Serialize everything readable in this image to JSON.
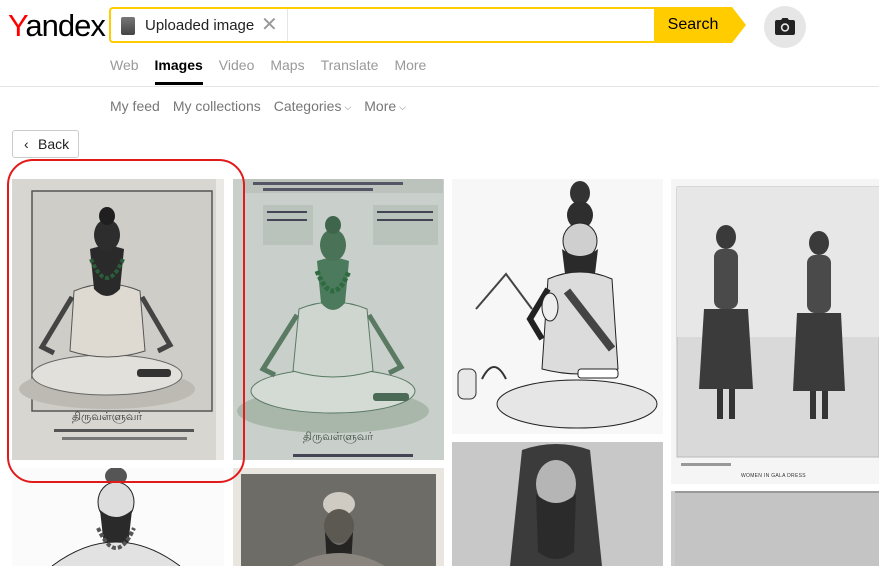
{
  "logo": {
    "first": "Y",
    "rest": "andex"
  },
  "search": {
    "uploaded_label": "Uploaded image",
    "clear_symbol": "✕",
    "button_label": "Search"
  },
  "services": [
    {
      "label": "Web"
    },
    {
      "label": "Images",
      "active": true
    },
    {
      "label": "Video"
    },
    {
      "label": "Maps"
    },
    {
      "label": "Translate"
    },
    {
      "label": "More"
    }
  ],
  "subnav": {
    "feed": "My feed",
    "collections": "My collections",
    "categories": "Categories",
    "more": "More",
    "chevron": "⌵"
  },
  "back": {
    "label": "Back",
    "chevron": "‹"
  },
  "icons": {
    "camera": "camera-icon",
    "clear": "close-icon",
    "back": "chevron-left-icon",
    "dropdown": "chevron-down-icon"
  },
  "colors": {
    "accent": "#ffcc00",
    "logo_red": "#ff0000",
    "highlight": "#e31a1a",
    "muted": "#999999"
  },
  "results": [
    {
      "caption": "திருவள்ளுவர்"
    },
    {
      "caption": "திருவள்ளுவர்"
    },
    {
      "caption": ""
    },
    {
      "caption": "WOMEN IN GALA DRESS"
    },
    {
      "caption": ""
    },
    {
      "caption": ""
    },
    {
      "caption": ""
    },
    {
      "caption": ""
    }
  ]
}
